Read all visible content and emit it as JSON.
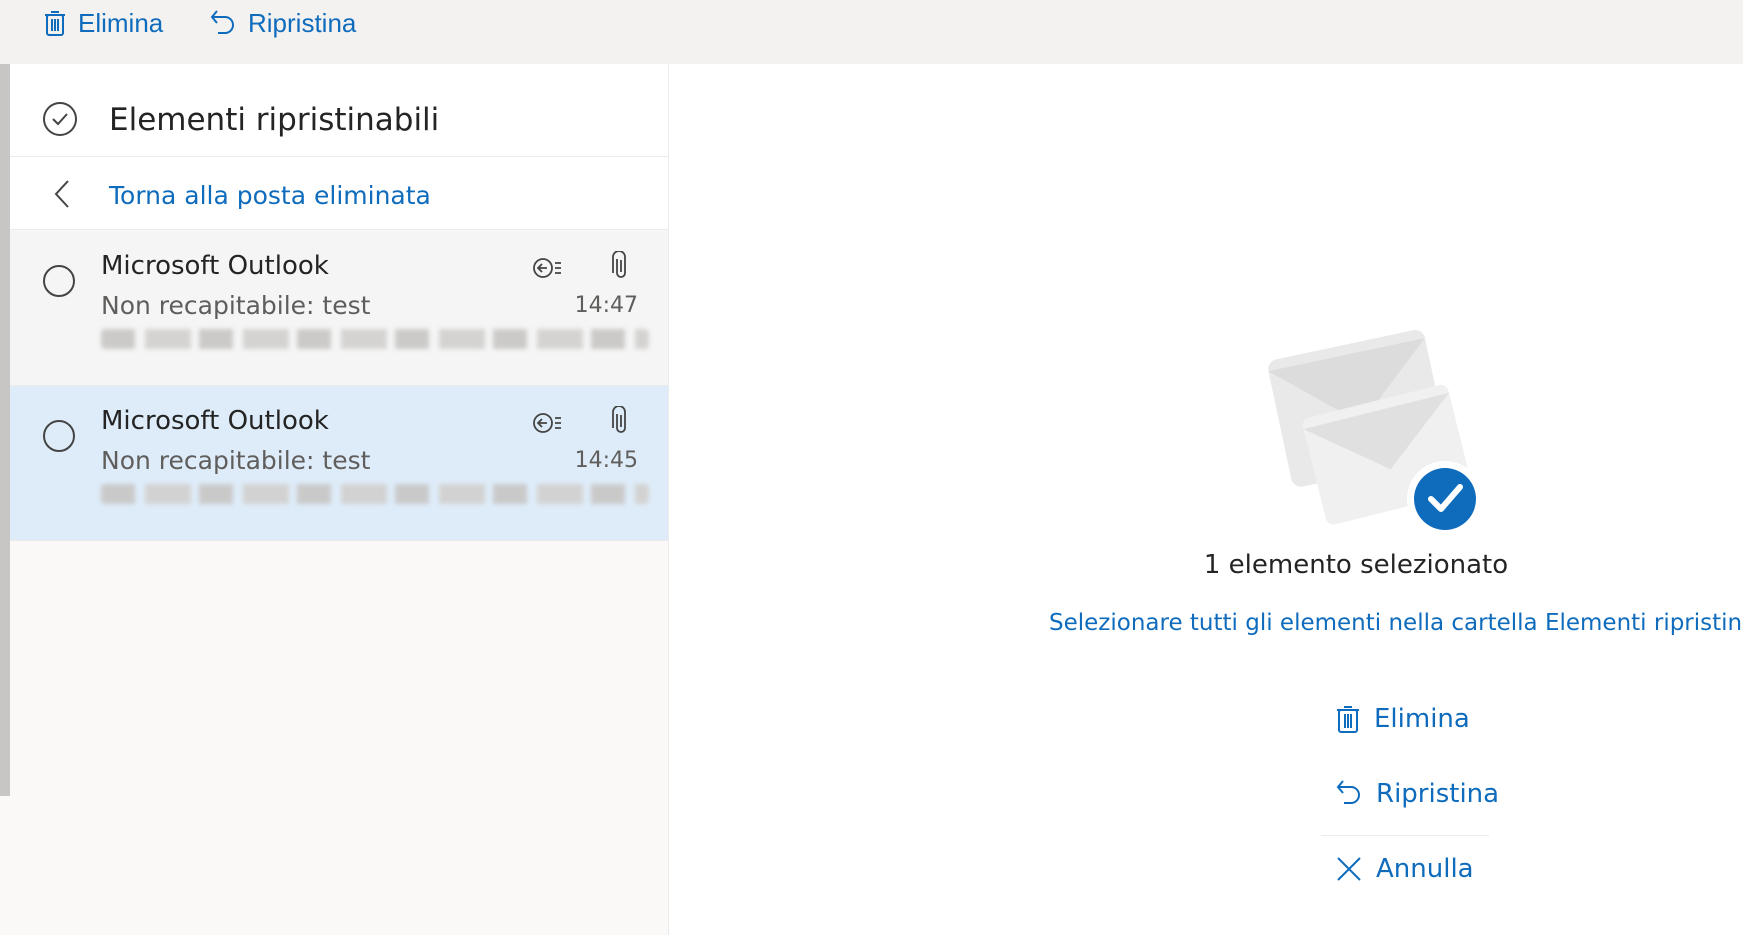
{
  "toolbar": {
    "delete_label": "Elimina",
    "restore_label": "Ripristina"
  },
  "folder": {
    "title": "Elementi ripristinabili",
    "back_link": "Torna alla posta eliminata"
  },
  "messages": [
    {
      "sender": "Microsoft Outlook",
      "subject": "Non recapitabile: test",
      "time": "14:47",
      "selected": false
    },
    {
      "sender": "Microsoft Outlook",
      "subject": "Non recapitabile: test",
      "time": "14:45",
      "selected": true
    }
  ],
  "reading_pane": {
    "selection_text": "1 elemento selezionato",
    "select_all_link": "Selezionare tutti gli elementi nella cartella Elementi ripristinabili",
    "actions": {
      "delete_label": "Elimina",
      "restore_label": "Ripristina",
      "cancel_label": "Annulla"
    }
  },
  "colors": {
    "accent": "#0f6cbd",
    "selected_row": "#deecf9",
    "check_badge": "#0f6cbd"
  },
  "icons": [
    "trash-icon",
    "undo-icon",
    "check-circle-icon",
    "chevron-left-icon",
    "reply-all-icon",
    "paperclip-icon",
    "close-icon",
    "envelope-check-illustration"
  ]
}
